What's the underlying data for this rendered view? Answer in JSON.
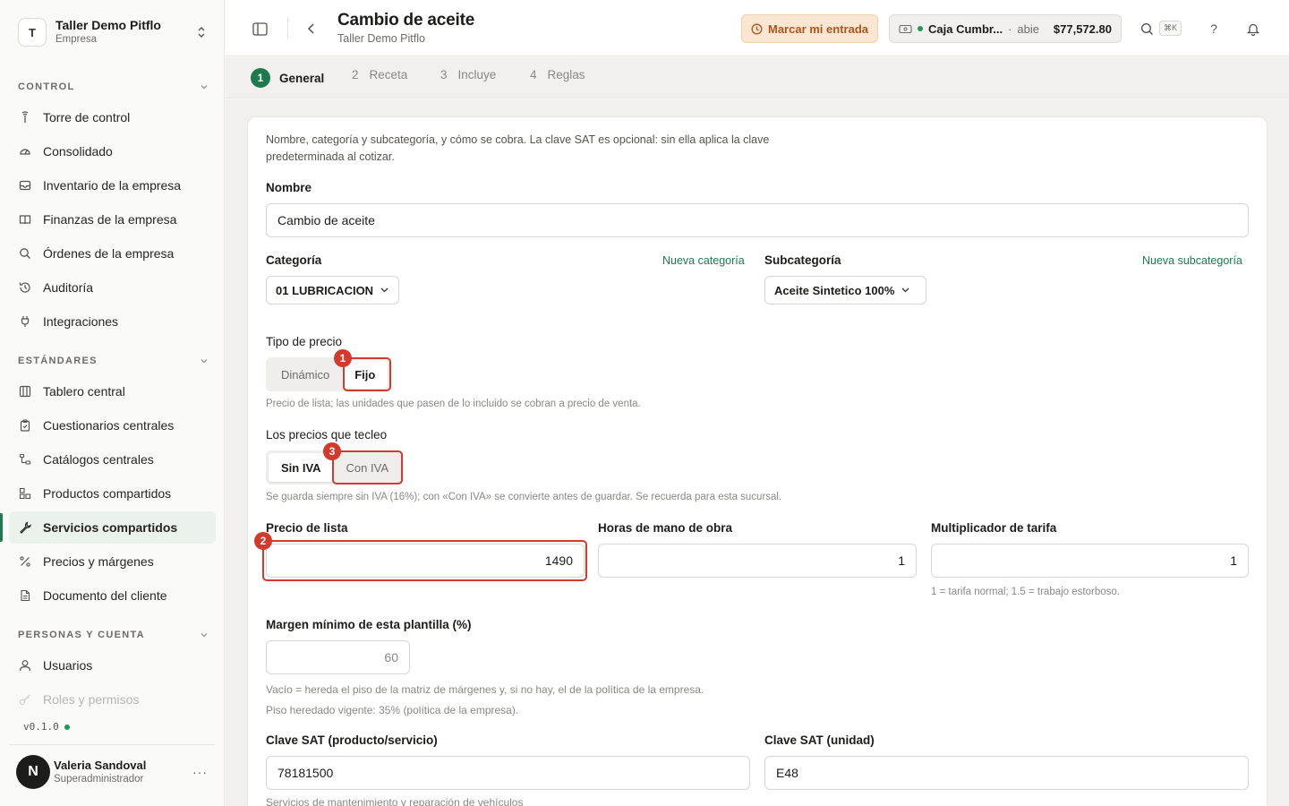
{
  "org": {
    "initial": "T",
    "name": "Taller Demo Pitflo",
    "type": "Empresa"
  },
  "sidebar": {
    "sections": [
      {
        "title": "CONTROL"
      },
      {
        "title": "ESTÁNDARES"
      },
      {
        "title": "PERSONAS Y CUENTA"
      }
    ],
    "items": [
      {
        "label": "Torre de control",
        "icon": "tower-icon"
      },
      {
        "label": "Consolidado",
        "icon": "gauge-icon"
      },
      {
        "label": "Inventario de la empresa",
        "icon": "inbox-icon"
      },
      {
        "label": "Finanzas de la empresa",
        "icon": "book-icon"
      },
      {
        "label": "Órdenes de la empresa",
        "icon": "search-icon"
      },
      {
        "label": "Auditoría",
        "icon": "history-icon"
      },
      {
        "label": "Integraciones",
        "icon": "plug-icon"
      },
      {
        "label": "Tablero central",
        "icon": "columns-icon"
      },
      {
        "label": "Cuestionarios centrales",
        "icon": "clipboard-icon"
      },
      {
        "label": "Catálogos centrales",
        "icon": "tree-icon"
      },
      {
        "label": "Productos compartidos",
        "icon": "boxes-icon"
      },
      {
        "label": "Servicios compartidos",
        "icon": "wrench-icon"
      },
      {
        "label": "Precios y márgenes",
        "icon": "percent-icon"
      },
      {
        "label": "Documento del cliente",
        "icon": "document-icon"
      },
      {
        "label": "Usuarios",
        "icon": "user-icon"
      },
      {
        "label": "Roles y permisos",
        "icon": "key-icon"
      }
    ],
    "version": "v0.1.0"
  },
  "user": {
    "initial": "N",
    "name": "Valeria Sandoval",
    "role": "Superadministrador",
    "more": "···"
  },
  "header": {
    "title": "Cambio de aceite",
    "subtitle": "Taller Demo Pitflo",
    "clockin_label": "Marcar mi entrada",
    "cash_name": "Caja Cumbr...",
    "cash_sep": "·",
    "cash_state": "abie",
    "cash_amount": "$77,572.80",
    "kbd": "⌘K",
    "help": "?"
  },
  "steps": [
    {
      "num": "1",
      "label": "General"
    },
    {
      "num": "2",
      "label": "Receta"
    },
    {
      "num": "3",
      "label": "Incluye"
    },
    {
      "num": "4",
      "label": "Reglas"
    }
  ],
  "form": {
    "intro": "Nombre, categoría y subcategoría, y cómo se cobra. La clave SAT es opcional: sin ella aplica la clave predeterminada al cotizar.",
    "name_label": "Nombre",
    "name_value": "Cambio de aceite",
    "category_label": "Categoría",
    "new_category": "Nueva categoría",
    "category_value": "01 LUBRICACION",
    "subcategory_label": "Subcategoría",
    "new_subcategory": "Nueva subcategoría",
    "subcategory_value": "Aceite Sintetico 100%",
    "price_type_label": "Tipo de precio",
    "price_type_options": [
      "Dinámico",
      "Fijo"
    ],
    "price_type_help": "Precio de lista; las unidades que pasen de lo incluido se cobran a precio de venta.",
    "tax_label": "Los precios que tecleo",
    "tax_options": [
      "Sin IVA",
      "Con IVA"
    ],
    "tax_help": "Se guarda siempre sin IVA (16%); con «Con IVA» se convierte antes de guardar. Se recuerda para esta sucursal.",
    "list_price_label": "Precio de lista",
    "list_price_value": "1490",
    "labor_hours_label": "Horas de mano de obra",
    "labor_hours_value": "1",
    "rate_mult_label": "Multiplicador de tarifa",
    "rate_mult_value": "1",
    "rate_mult_help": "1 = tarifa normal; 1.5 = trabajo estorboso.",
    "min_margin_label": "Margen mínimo de esta plantilla (%)",
    "min_margin_placeholder": "60",
    "min_margin_help1": "Vacío = hereda el piso de la matriz de márgenes y, si no hay, el de la política de la empresa.",
    "min_margin_help2": "Piso heredado vigente: 35% (política de la empresa).",
    "sat_product_label": "Clave SAT (producto/servicio)",
    "sat_product_value": "78181500",
    "sat_product_help": "Servicios de mantenimiento y reparación de vehículos",
    "sat_unit_label": "Clave SAT (unidad)",
    "sat_unit_value": "E48"
  },
  "annotations": [
    "1",
    "2",
    "3"
  ],
  "colors": {
    "accent": "#1f7a4d",
    "highlight": "#d33a2c",
    "clockin_bg": "#fbe6d2"
  }
}
